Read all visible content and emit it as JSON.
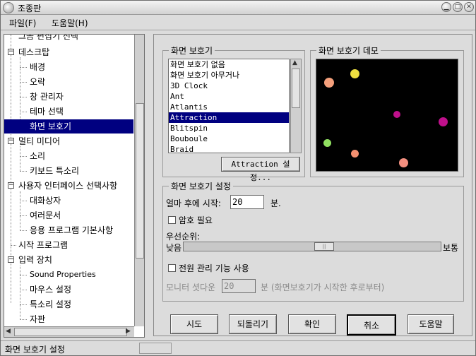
{
  "window": {
    "title": "조종판",
    "icons": {
      "app": "gnome-foot-icon",
      "minimize": "minimize-icon",
      "maximize": "maximize-icon",
      "close": "close-icon"
    }
  },
  "menubar": {
    "items": [
      "파일(F)",
      "도움말(H)"
    ]
  },
  "tree": {
    "partial_top": "그놈 편집기 선택",
    "items": [
      {
        "label": "데스크탑",
        "level": 0,
        "expanded": true
      },
      {
        "label": "배경",
        "level": 1
      },
      {
        "label": "오락",
        "level": 1
      },
      {
        "label": "창 관리자",
        "level": 1
      },
      {
        "label": "테마 선택",
        "level": 1
      },
      {
        "label": "화면 보호기",
        "level": 1,
        "selected": true
      },
      {
        "label": "멀티 미디어",
        "level": 0,
        "expanded": true
      },
      {
        "label": "소리",
        "level": 1
      },
      {
        "label": "키보드 특소리",
        "level": 1
      },
      {
        "label": "사용자 인터페이스 선택사항",
        "level": 0,
        "expanded": true
      },
      {
        "label": "대화상자",
        "level": 1
      },
      {
        "label": "여러문서",
        "level": 1
      },
      {
        "label": "응용 프로그램 기본사항",
        "level": 1
      },
      {
        "label": "시작 프로그램",
        "level": 0,
        "leaf": true
      },
      {
        "label": "입력 장치",
        "level": 0,
        "expanded": true
      },
      {
        "label": "Sound Properties",
        "level": 1
      },
      {
        "label": "마우스 설정",
        "level": 1
      },
      {
        "label": "특소리 설정",
        "level": 1
      },
      {
        "label": "자판",
        "level": 1
      }
    ]
  },
  "screensaver": {
    "group_label": "화면 보호기",
    "list": [
      "화면 보호기 없음",
      "화면 보호기 아무거나",
      "3D Clock",
      "Ant",
      "Atlantis",
      "Attraction",
      "Blitspin",
      "Bouboule",
      "Braid"
    ],
    "selected": "Attraction",
    "settings_button": "Attraction 설정..."
  },
  "demo": {
    "group_label": "화면 보호기 데모",
    "dots": [
      {
        "color": "#f4a07c"
      },
      {
        "color": "#f0e040"
      },
      {
        "color": "#c0108c"
      },
      {
        "color": "#c0108c"
      },
      {
        "color": "#90e060"
      },
      {
        "color": "#f49070"
      },
      {
        "color": "#f49080"
      }
    ]
  },
  "settings": {
    "group_label": "화면 보호기 설정",
    "start_after_label": "얼마 후에 시작:",
    "start_after_value": "20",
    "start_after_unit": "분.",
    "password_label": "암호 필요",
    "password_checked": false,
    "priority_label": "우선순위:",
    "priority_low": "낮음",
    "priority_high": "보통",
    "priority_level": 0.55,
    "power_label": "전원 관리 기능 사용",
    "power_checked": false,
    "monitor_label": "모니터 셧다운",
    "monitor_value": "20",
    "monitor_unit": "분 (화면보호기가 시작한 후로부터)"
  },
  "buttons": {
    "try": "시도",
    "revert": "되돌리기",
    "ok": "확인",
    "cancel": "취소",
    "help": "도움말"
  },
  "statusbar": {
    "text": "화면 보호기 설정"
  }
}
